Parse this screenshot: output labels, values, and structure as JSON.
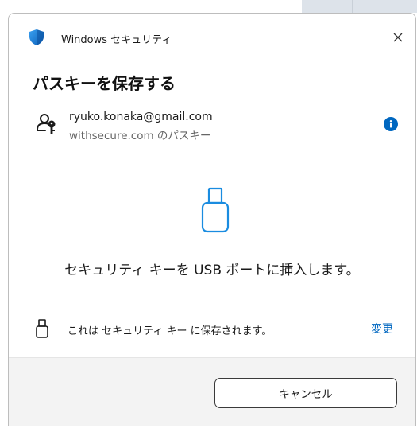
{
  "window": {
    "app_title": "Windows セキュリティ",
    "close_glyph": "✕"
  },
  "dialog": {
    "heading": "パスキーを保存する",
    "account": {
      "email": "ryuko.konaka@gmail.com",
      "subtitle": "withsecure.com のパスキー",
      "info_glyph": "i"
    },
    "instruction": "セキュリティ キーを USB ポートに挿入します。",
    "save_location": {
      "text": "これは セキュリティ キー に保存されます。",
      "change_label": "変更"
    },
    "cancel_label": "キャンセル"
  },
  "icons": {
    "app": "windows-security-shield-icon",
    "account": "person-key-icon",
    "info": "info-icon",
    "usb_large": "usb-key-icon",
    "usb_small": "usb-key-icon",
    "close": "close-icon"
  },
  "colors": {
    "accent": "#0067c0",
    "usb_icon": "#1a8ce0",
    "footer_bg": "#f3f3f3"
  }
}
